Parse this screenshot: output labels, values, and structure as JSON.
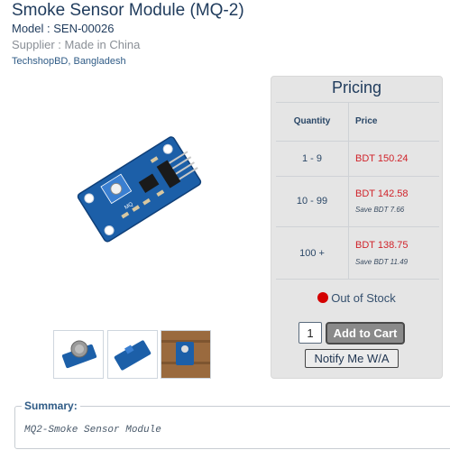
{
  "product": {
    "title": "Smoke Sensor Module (MQ-2)",
    "model": "Model : SEN-00026",
    "supplier": "Supplier : Made in China",
    "location": "TechshopBD, Bangladesh"
  },
  "thumbnails": [
    {
      "name": "thumbnail-mq2-top"
    },
    {
      "name": "thumbnail-mq2-board"
    },
    {
      "name": "thumbnail-mq2-wood"
    }
  ],
  "pricing": {
    "title": "Pricing",
    "headers": {
      "quantity": "Quantity",
      "price": "Price"
    },
    "rows": [
      {
        "qty": "1 - 9",
        "price": "BDT 150.24",
        "save": ""
      },
      {
        "qty": "10 - 99",
        "price": "BDT 142.58",
        "save": "Save BDT 7.66"
      },
      {
        "qty": "100 +",
        "price": "BDT 138.75",
        "save": "Save BDT 11.49"
      }
    ],
    "stock_status": "Out of Stock",
    "stock_color": "#d40000",
    "quantity_value": "1",
    "add_to_cart_label": "Add to Cart",
    "notify_label": "Notify Me W/A"
  },
  "summary": {
    "label": "Summary:",
    "text": "MQ2-Smoke Sensor Module"
  }
}
